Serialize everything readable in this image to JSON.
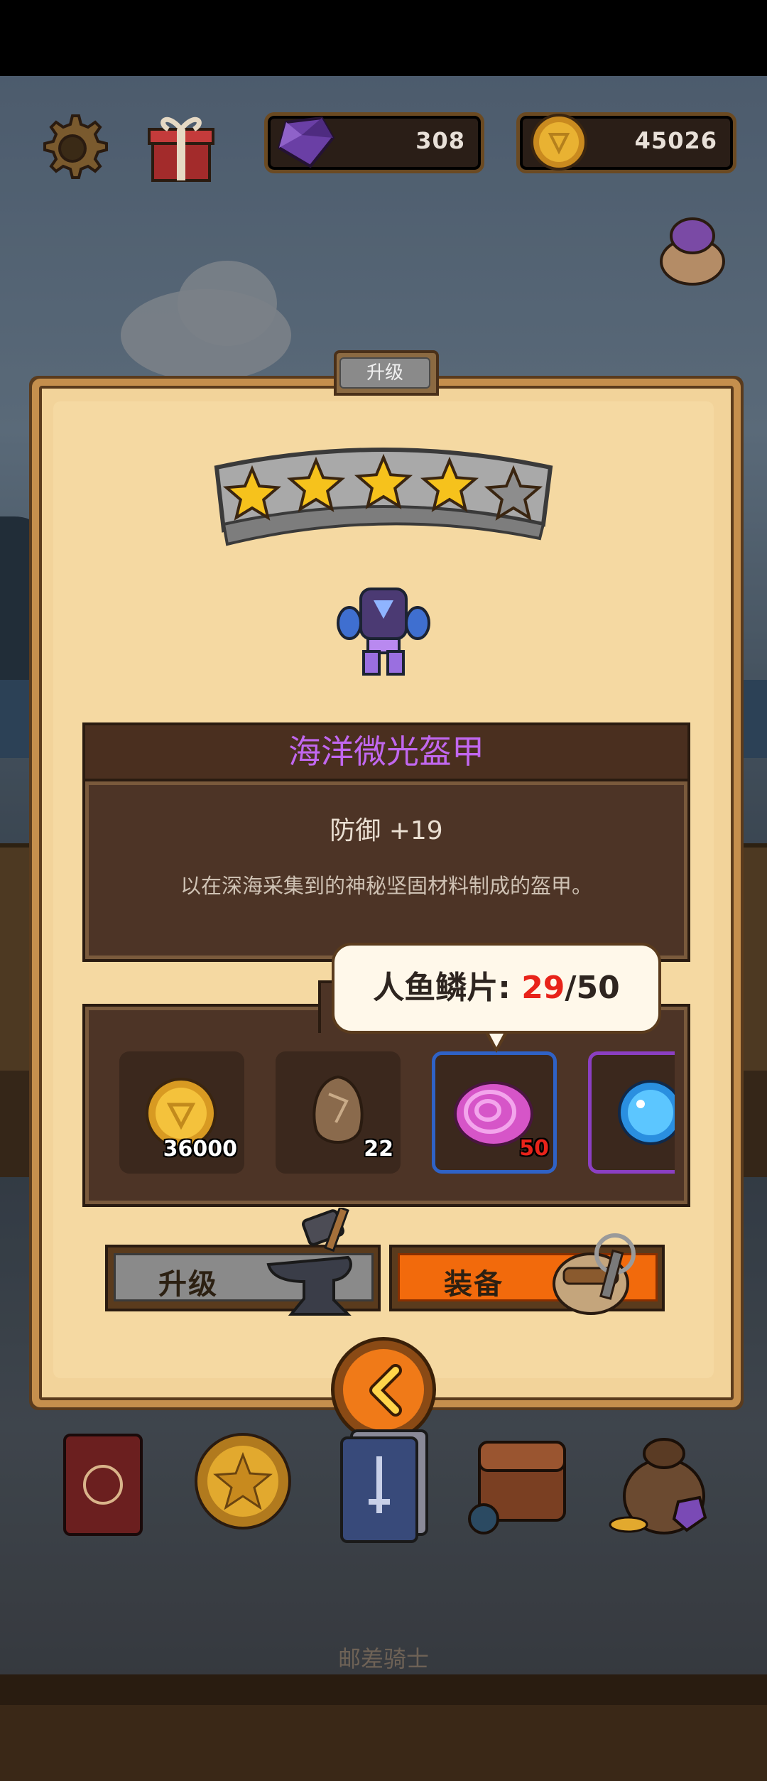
{
  "colors": {
    "gem_purple": "#6a3fa5",
    "coin_gold": "#e9b232",
    "item_name": "#c167ef",
    "tooltip_highlight": "#e8231a",
    "equip_button": "#f26a0c",
    "upgrade_button": "#8a8a8a"
  },
  "top_bar": {
    "settings_icon": "gear-icon",
    "gift_icon": "gift-box-icon",
    "gems": "308",
    "coins": "45026",
    "pouch_icon": "gem-pouch-icon"
  },
  "panel": {
    "tab_label": "升级",
    "star_rating": {
      "filled": 4,
      "total": 5
    },
    "item_icon": "ocean-armor-icon",
    "item_name": "海洋微光盔甲",
    "stat": "防御 +19",
    "description": "以在深海采集到的神秘坚固材料制成的盔甲。"
  },
  "materials": {
    "tooltip": {
      "label": "人鱼鳞片: ",
      "have": "29",
      "sep": "/",
      "need": "50"
    },
    "slots": [
      {
        "icon": "gold-coin-icon",
        "count": "36000"
      },
      {
        "icon": "rough-stone-icon",
        "count": "22"
      },
      {
        "icon": "mermaid-scale-icon",
        "count": "50"
      },
      {
        "icon": "blue-orb-icon",
        "count": ""
      }
    ]
  },
  "buttons": {
    "upgrade_label": "升级",
    "equip_label": "装备",
    "back_icon": "chevron-left-icon"
  },
  "bottom_nav": [
    {
      "icon": "book-icon"
    },
    {
      "icon": "star-coin-icon"
    },
    {
      "icon": "cards-icon"
    },
    {
      "icon": "backpack-icon"
    },
    {
      "icon": "loot-bag-icon"
    }
  ],
  "footer": {
    "title": "邮差骑士"
  }
}
